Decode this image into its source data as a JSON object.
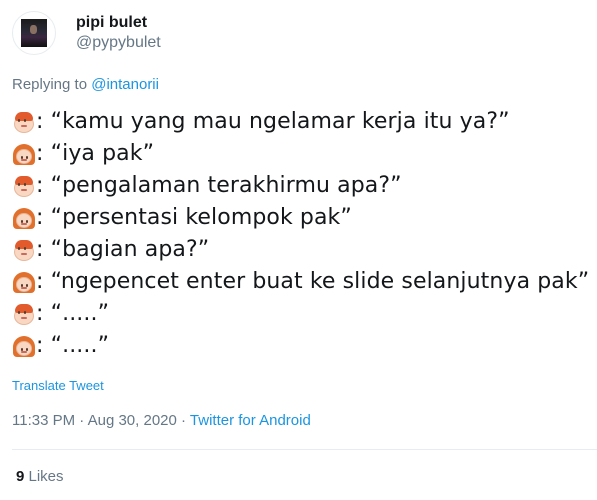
{
  "author": {
    "display_name": "pipi bulet",
    "handle": "@pypybulet"
  },
  "reply": {
    "prefix": "Replying to ",
    "to_handle": "@intanorii"
  },
  "tweet": {
    "lines": [
      {
        "speaker": "man",
        "icon": "man-emoji-icon",
        "text": ": “kamu yang mau ngelamar kerja itu ya?”"
      },
      {
        "speaker": "woman",
        "icon": "woman-emoji-icon",
        "text": ": “iya pak”"
      },
      {
        "speaker": "man",
        "icon": "man-emoji-icon",
        "text": ": “pengalaman terakhirmu apa?”"
      },
      {
        "speaker": "woman",
        "icon": "woman-emoji-icon",
        "text": ": “persentasi kelompok pak”"
      },
      {
        "speaker": "man",
        "icon": "man-emoji-icon",
        "text": ": “bagian apa?”"
      },
      {
        "speaker": "woman",
        "icon": "woman-emoji-icon",
        "text": ": “ngepencet enter buat ke slide selanjutnya pak”"
      },
      {
        "speaker": "man",
        "icon": "man-emoji-icon",
        "text": ": “.....”"
      },
      {
        "speaker": "woman",
        "icon": "woman-emoji-icon",
        "text": ": “.....”"
      }
    ],
    "translate_label": "Translate Tweet"
  },
  "meta": {
    "time": "11:33 PM",
    "separator1": " · ",
    "date": "Aug 30, 2020",
    "separator2": " · ",
    "source": "Twitter for Android"
  },
  "stats": {
    "likes_count": "9",
    "likes_label": " Likes"
  },
  "colors": {
    "link": "#1b95e0",
    "secondary_text": "#657786",
    "primary_text": "#14171a"
  }
}
